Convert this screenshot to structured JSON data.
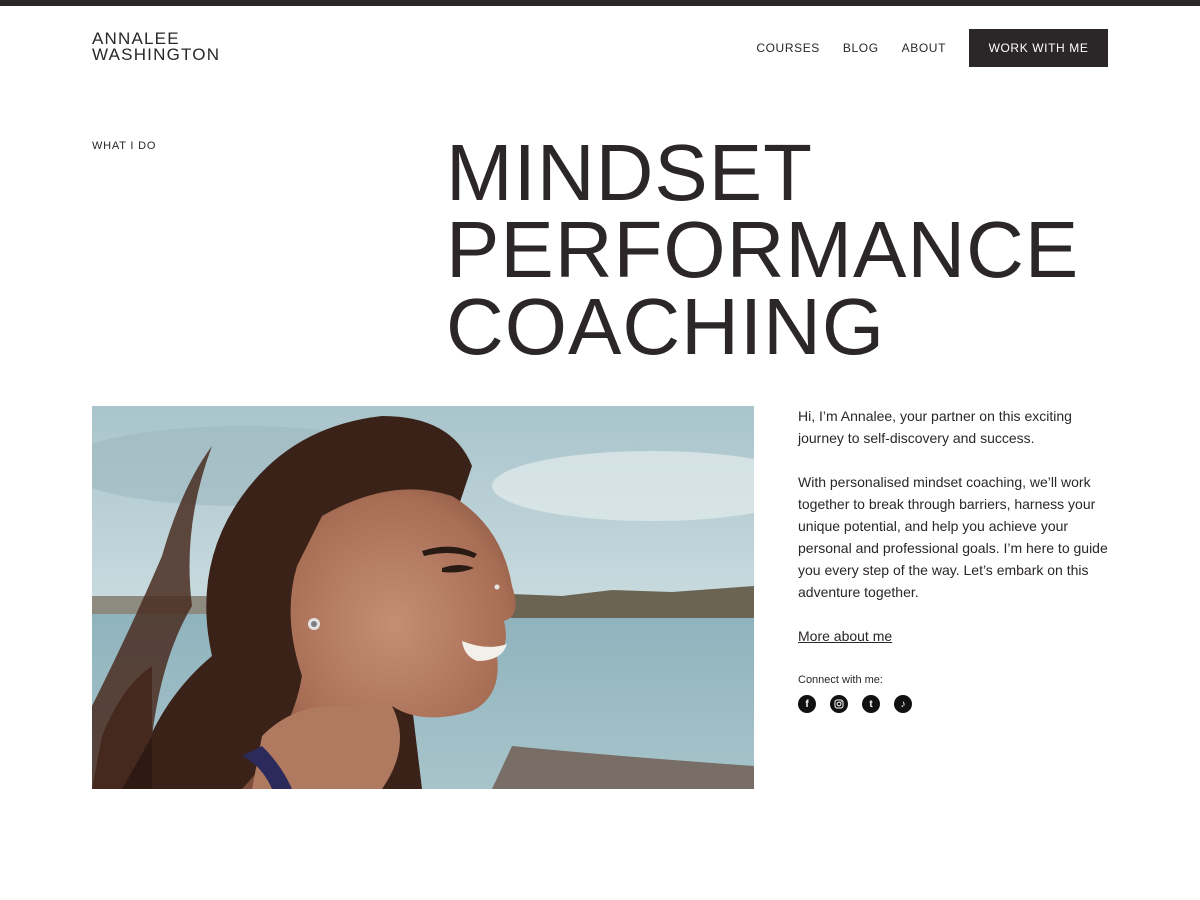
{
  "brand": {
    "line1": "ANNALEE",
    "line2": "WASHINGTON"
  },
  "nav": {
    "items": [
      {
        "label": "COURSES"
      },
      {
        "label": "BLOG"
      },
      {
        "label": "ABOUT"
      }
    ],
    "cta_label": "WORK WITH ME"
  },
  "section": {
    "eyebrow": "WHAT I DO"
  },
  "hero": {
    "title_lines": [
      "MINDSET",
      "PERFORMANCE",
      "COACHING"
    ]
  },
  "intro": {
    "paragraphs": [
      "Hi, I’m Annalee, your partner on this exciting journey to self-discovery and success.",
      "With personalised mindset coaching, we’ll work together to break through barriers, harness your unique potential, and help you achieve your personal and professional goals. I’m here to guide you every step of the way. Let’s embark on this adventure together."
    ],
    "more_link": "More about me",
    "connect_label": "Connect with me:",
    "socials": [
      {
        "icon": "facebook-icon",
        "glyph": "f"
      },
      {
        "icon": "instagram-icon",
        "glyph": ""
      },
      {
        "icon": "tumblr-icon",
        "glyph": "t"
      },
      {
        "icon": "tiktok-icon",
        "glyph": "♪"
      }
    ]
  },
  "colors": {
    "text": "#2b2627",
    "button_bg": "#2b2627",
    "button_text": "#ffffff",
    "background": "#ffffff"
  }
}
